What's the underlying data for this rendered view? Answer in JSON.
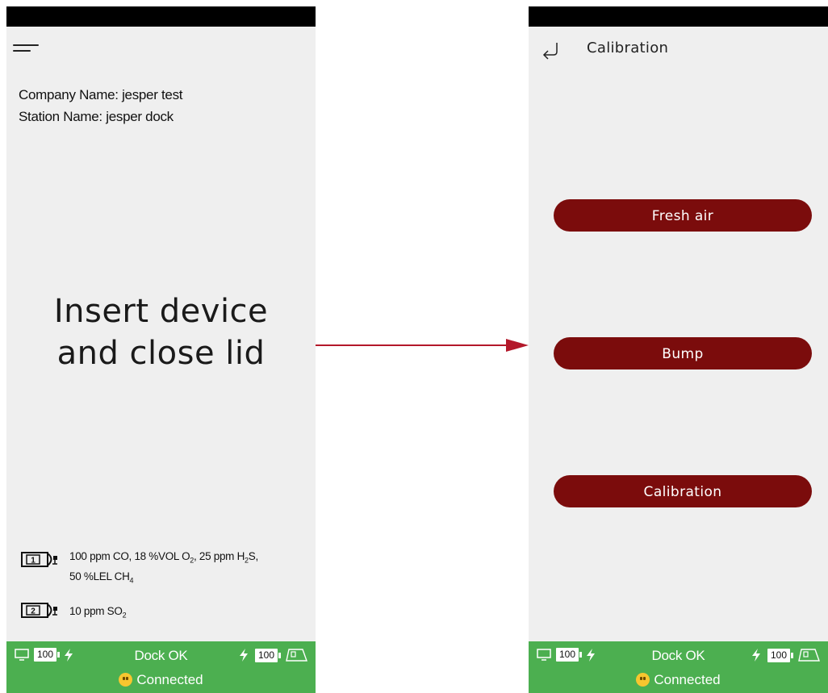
{
  "left_screen": {
    "company_line": "Company Name: jesper test",
    "station_line": "Station Name: jesper dock",
    "insert_message_line1": "Insert device",
    "insert_message_line2": "and close lid",
    "gas_slots": [
      {
        "slot": "1",
        "line1_html": "100 ppm CO, 18 %VOL O<sub>2</sub>, 25 ppm H<sub>2</sub>S,",
        "line2_html": "50 %LEL CH<sub>4</sub>"
      },
      {
        "slot": "2",
        "line1_html": "10 ppm SO<sub>2</sub>"
      }
    ]
  },
  "right_screen": {
    "title": "Calibration",
    "buttons": [
      "Fresh air",
      "Bump",
      "Calibration"
    ]
  },
  "status_bar": {
    "left_battery": "100",
    "right_battery": "100",
    "dock_status": "Dock OK",
    "connection_status": "Connected"
  },
  "icons": [
    "hamburger-menu-icon",
    "gas-cylinder-icon",
    "monitor-icon",
    "lightning-icon",
    "battery-icon",
    "device-icon",
    "smiley-icon",
    "back-arrow-icon",
    "flow-arrow-icon"
  ],
  "colors": {
    "status_green": "#4caf50",
    "button_maroon": "#7b0c0c",
    "arrow_red": "#b3182a",
    "screen_bg": "#efefef"
  }
}
